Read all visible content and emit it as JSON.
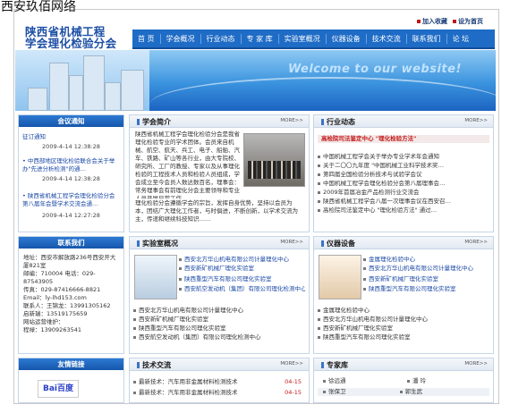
{
  "watermark": "西安玖佰网络",
  "top_links": [
    "加入收藏",
    "设为首页"
  ],
  "logo": {
    "line1": "陕西省机械工程",
    "line2": "学会理化检验分会"
  },
  "nav": [
    "首 页",
    "学会概况",
    "行业动态",
    "专 家 库",
    "实验室概况",
    "仪器设备",
    "技术交流",
    "联系我们",
    "论 坛"
  ],
  "banner": {
    "welcome": "Welcome to our website!"
  },
  "notice": {
    "title": "会议通知",
    "items": [
      {
        "text": "征订通知",
        "date": "2009-4-14 12:38:28"
      },
      {
        "text": "• 中西部地区理化检验联合会关于举办\"先进分析检测\"的通…",
        "date": "2009-4-14 12:38:28"
      },
      {
        "text": "• 陕西省机械工程学会理化检验分会第八届年会暨学术交流会通…",
        "date": "2009-4-14 12:27:28"
      }
    ]
  },
  "intro": {
    "title": "学会简介",
    "more": "MORE>>",
    "p1": "陕西省机械工程学会理化检验分会是我省理化检验专业的学术团体。会员来自机械、航空、航天、兵工、电子、船舶、汽车、铁路、矿山等各行业，由大专院校、研究所、工厂的教授、专家以及从事理化检验的工程技术人员和检验人员组成，学会成立至今会员人数达数百名，理事会：常务理事会有前理化分会主要领导和专业人员开展日常工作。",
    "p2": "理化检验分会遵循学会的宗旨，发挥自身优势，坚持以会员为本，团结广大理化工作者，与时俱进，不断创新，以学术交流为主，传递和继续科技知识……"
  },
  "news": {
    "title": "行业动态",
    "more": "MORE>>",
    "headline": "高检院司法鉴定中心 \"理化检验方法\"",
    "items": [
      "中国机械工程学会关于举办专业学术年会通知",
      "关于二〇〇九年度 \"中国机械工业科学技术奖…",
      "第四届全国检验分析技术与试验学会议",
      "中国机械工程学会理化检验分会第八届理事会…",
      "2009年首届冶金产品检测行业交流会",
      "陕西省机械工程学会八届一次理事会议在西安召…",
      "高检院司法鉴定中心 \"理化检验方法\" 通过…"
    ]
  },
  "contact": {
    "title": "联系我们",
    "lines": [
      "地址：西安市解放路236号西安开大厦821室",
      "邮编：710004  电话：029-87543905",
      "传真：029-87416666-8821",
      "Email：ly-lhd153.com",
      "联系人：王锦龙：13991305162",
      "启新瑞：13519175659",
      "网站运营维护：",
      "程禄：13909263541"
    ]
  },
  "lab": {
    "title": "实验室概况",
    "more": "MORE>>",
    "side_items": [
      "西安北方华山机电有限公司计量理化中心",
      "西安新矿机械厂理化实验室",
      "陕西重型汽车有限公司理化实验室",
      "西安航空发动机（集团）有限公司理化检测中心"
    ],
    "list": [
      "西安北方华山机电有限公司计量理化中心",
      "西安新矿机械厂理化实验室",
      "陕西重型汽车有限公司理化实验室",
      "西安航空发动机（集团）有限公司理化检测中心"
    ]
  },
  "equipment": {
    "title": "仪器设备",
    "more": "MORE>>",
    "side_items": [
      "金属理化检验中心",
      "西安北方华山机电有限公司计量理化中心",
      "西安新矿机械厂理化实验室",
      "陕西重型汽车有限公司理化实验室"
    ],
    "list": [
      "金属理化检验中心",
      "西安北方华山机电有限公司计量理化中心",
      "西安新矿机械厂理化实验室",
      "陕西重型汽车有限公司理化实验室"
    ]
  },
  "links": {
    "title": "友情链接",
    "baidu": "Bai百度"
  },
  "tech": {
    "title": "技术交流",
    "more": "MORE>>",
    "items": [
      {
        "text": "最新技术：汽车用非金属材料检测技术",
        "date": "04-15"
      },
      {
        "text": "最新技术：汽车用非金属材料检测技术",
        "date": "04-15"
      }
    ]
  },
  "experts": {
    "title": "专家库",
    "more": "MORE>>",
    "names": [
      [
        "徐远通",
        "潘 玲"
      ],
      [
        "张保卫",
        "郭生武"
      ]
    ]
  }
}
